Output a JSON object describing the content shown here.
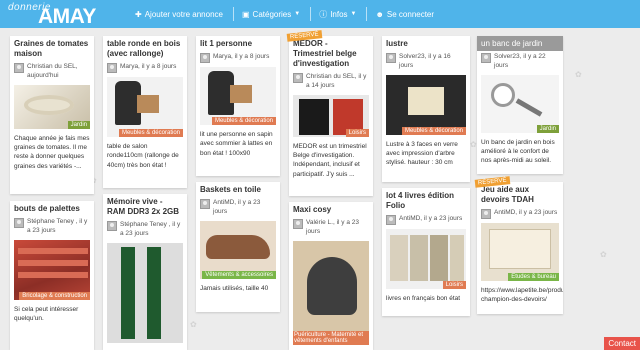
{
  "header": {
    "logo_line1": "donnerie",
    "logo_line2": "AMAY",
    "nav": [
      {
        "label": "Ajouter votre annonce",
        "icon": "pin-icon"
      },
      {
        "label": "Catégories",
        "icon": "folder-icon"
      },
      {
        "label": "Infos",
        "icon": "info-icon"
      },
      {
        "label": "Se connecter",
        "icon": "user-icon"
      }
    ]
  },
  "badges": {
    "reserve": "RÉSERVÉ"
  },
  "category_colors": {
    "Jardin": "#7ea03a",
    "Meubles & décoration": "#e07b52",
    "Bricolage & construction": "#e07b52",
    "Vêtements & accessoires": "#7ab648",
    "Loisirs": "#e07b52",
    "Puériculture": "#e07b52",
    "Etudes & bureau": "#7ab648"
  },
  "cards": {
    "tomates": {
      "title": "Graines de tomates maison",
      "author": "Christian du SEL, aujourd'hui",
      "category": "Jardin",
      "desc": "Chaque année je fais mes graines de tomates. Il me reste à donner quelques graines des variétés -..."
    },
    "table": {
      "title": "table ronde en bois (avec rallonge)",
      "author": "Marya, il y a 8 jours",
      "category": "Meubles & décoration",
      "desc": "table de salon ronde110cm (rallonge de 40cm) très bon état !"
    },
    "lit": {
      "title": "lit 1 personne",
      "author": "Marya, il y a 8 jours",
      "category": "Meubles & décoration",
      "desc": "lit une personne en sapin avec sommier à lattes en bon état ! 100x90"
    },
    "medor": {
      "title": "MEDOR - Trimestriel belge d'investigation",
      "author": "Christian du SEL, il y a 14 jours",
      "category": "Loisirs",
      "desc": "MEDOR est un trimestriel Belge d'investigation. Indépendant, inclusif et participatif. J'y suis ..."
    },
    "lustre": {
      "title": "lustre",
      "author": "Solver23, il y a 16 jours",
      "category": "Meubles & décoration",
      "desc": "Lustre à 3 faces en verre avec impression d'arbre stylisé. hauteur : 30 cm"
    },
    "banc": {
      "title": "un banc de jardin",
      "author": "Solver23, il y a 22 jours",
      "category": "Jardin",
      "desc": "Un banc de jardin en bois amélioré à le confort de nos après-midi au soleil."
    },
    "palettes": {
      "title": "bouts de palettes",
      "author": "Stéphane Teney , il y a 23 jours",
      "category": "Bricolage & construction",
      "desc": "Si cela peut intéresser quelqu'un."
    },
    "memoire": {
      "title": "Mémoire vive - RAM DDR3 2x 2GB",
      "author": "Stéphane Teney , il y a 23 jours",
      "category": "",
      "desc": ""
    },
    "basket": {
      "title": "Baskets en toile",
      "author": "AntiMD, il y a 23 jours",
      "category": "Vêtements & accessoires",
      "desc": "Jamais utilisés, taille 40"
    },
    "maxi": {
      "title": "Maxi cosy",
      "author": "Valérie L., il y a 23 jours",
      "category": "Puériculture - Maternité et vêtements d'enfants",
      "desc": ""
    },
    "folio": {
      "title": "lot 4 livres édition Folio",
      "author": "AntiMD, il y a 23 jours",
      "category": "Loisirs",
      "desc": "livres en français bon état"
    },
    "devoirs": {
      "title": "Jeu aide aux devoirs TDAH",
      "author": "AntiMD, il y a 23 jours",
      "category": "Etudes & bureau",
      "desc": "https://www.lapetite.be/produit/ champion-des-devoirs/"
    }
  },
  "contact_label": "Contact"
}
